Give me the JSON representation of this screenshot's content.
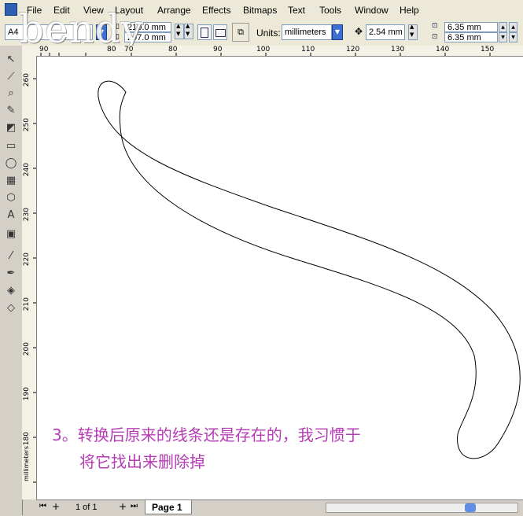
{
  "menubar": {
    "items": [
      "File",
      "Edit",
      "View",
      "Layout",
      "Arrange",
      "Effects",
      "Bitmaps",
      "Text",
      "Tools",
      "Window",
      "Help"
    ]
  },
  "propbar": {
    "paper_preset": "A4",
    "width": "210.0 mm",
    "height": "297.0 mm",
    "units_label": "Units:",
    "units_value": "millimeters",
    "nudge": "2.54 mm",
    "dup_x": "6.35 mm",
    "dup_y": "6.35 mm"
  },
  "rulers": {
    "h_ticks": [
      "90",
      "80",
      "70",
      "80",
      "90",
      "100",
      "110",
      "120",
      "130",
      "140",
      "150"
    ],
    "v_ticks": [
      "260",
      "250",
      "240",
      "230",
      "220",
      "210",
      "200",
      "190",
      "180"
    ],
    "unit_label": "millimeters"
  },
  "status": {
    "page_count": "1 of 1",
    "page_tab": "Page 1"
  },
  "watermark": "bendy",
  "caption": {
    "line1": "3。转换后原来的线条还是存在的，我习惯于",
    "line2": "将它找出来删除掉"
  },
  "colors": {
    "caption": "#b43cb4",
    "chrome": "#d4d0c8",
    "menubar": "#ece9d8"
  }
}
